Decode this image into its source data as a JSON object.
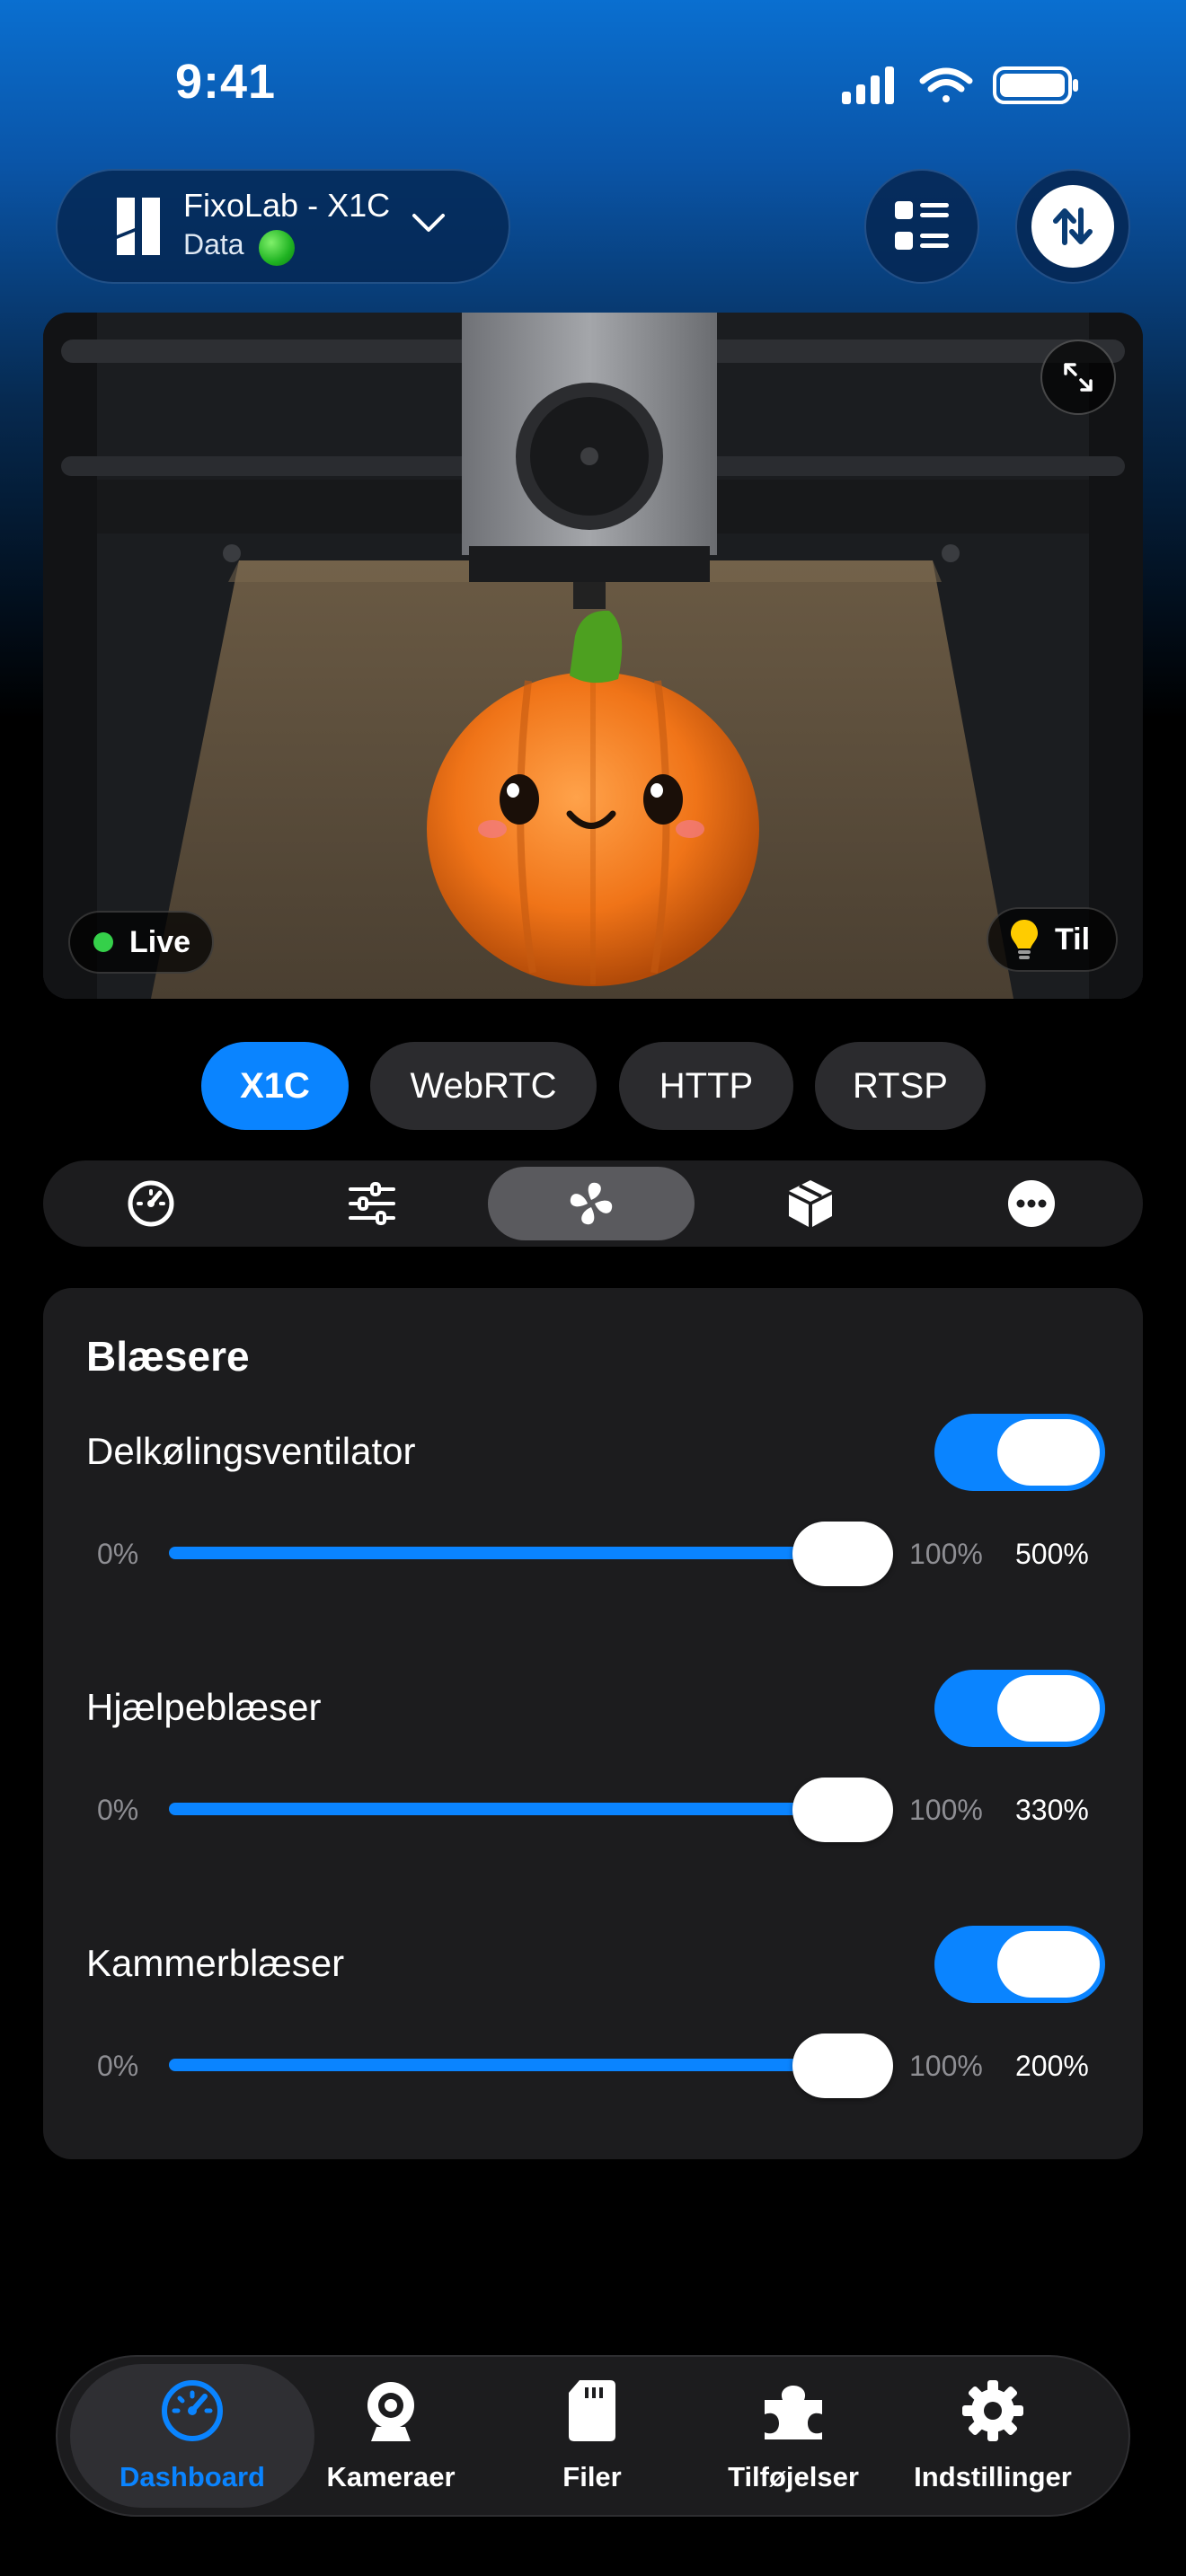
{
  "status_bar": {
    "time": "9:41"
  },
  "printer": {
    "name": "FixoLab - X1C",
    "status": "Data",
    "status_color": "#1fb322"
  },
  "camera": {
    "live_label": "Live",
    "light_label": "Til",
    "live_color": "#35d04a"
  },
  "stream_tabs": [
    {
      "label": "X1C",
      "active": true
    },
    {
      "label": "WebRTC",
      "active": false
    },
    {
      "label": "HTTP",
      "active": false
    },
    {
      "label": "RTSP",
      "active": false
    }
  ],
  "section_icons": [
    "gauge-icon",
    "sliders-icon",
    "fan-icon",
    "box-icon",
    "more-icon"
  ],
  "selected_section": "fan-icon",
  "fans": {
    "title": "Blæsere",
    "items": [
      {
        "name": "Delkølingsventilator",
        "enabled": true,
        "min_label": "0%",
        "max_label": "100%",
        "value_label": "500%",
        "level": 1.0
      },
      {
        "name": "Hjælpeblæser",
        "enabled": true,
        "min_label": "0%",
        "max_label": "100%",
        "value_label": "330%",
        "level": 1.0
      },
      {
        "name": "Kammerblæser",
        "enabled": true,
        "min_label": "0%",
        "max_label": "100%",
        "value_label": "200%",
        "level": 1.0
      }
    ]
  },
  "tab_bar": [
    {
      "label": "Dashboard",
      "icon": "gauge-icon",
      "active": true
    },
    {
      "label": "Kameraer",
      "icon": "webcam-icon",
      "active": false
    },
    {
      "label": "Filer",
      "icon": "sd-card-icon",
      "active": false
    },
    {
      "label": "Tilføjelser",
      "icon": "puzzle-icon",
      "active": false
    },
    {
      "label": "Indstillinger",
      "icon": "gear-icon",
      "active": false
    }
  ],
  "colors": {
    "accent": "#0a84ff"
  }
}
